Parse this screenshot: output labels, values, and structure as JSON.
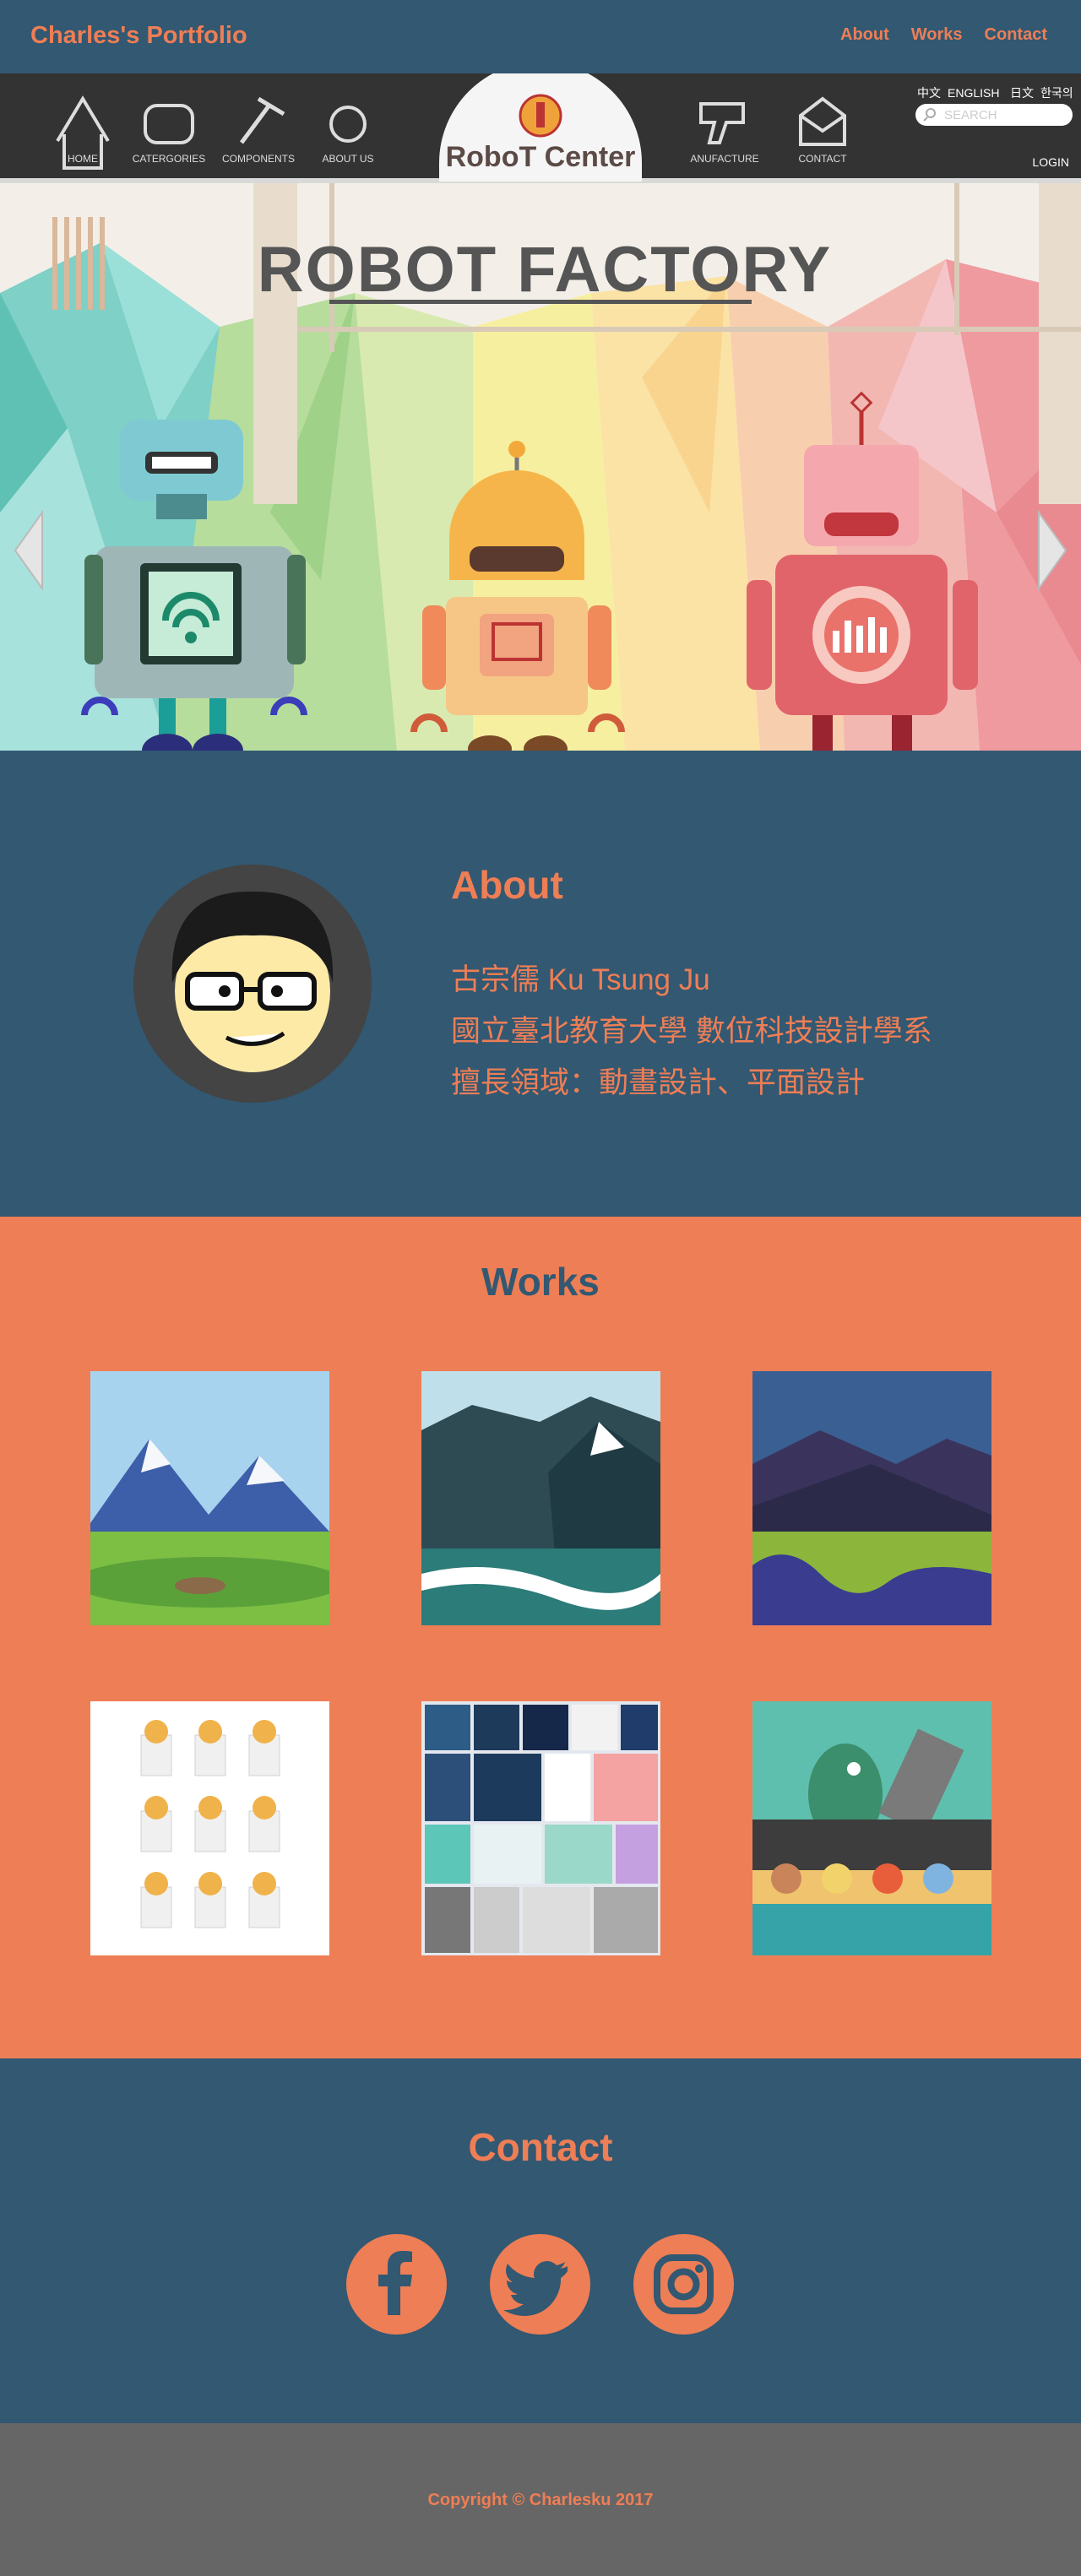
{
  "nav": {
    "brand": "Charles's Portfolio",
    "links": [
      "About",
      "Works",
      "Contact"
    ]
  },
  "hero": {
    "menu": [
      "HOME",
      "CATERGORIES",
      "COMPONENTS",
      "ABOUT US",
      "ANUFACTURE",
      "CONTACT"
    ],
    "logo_text": "RoboT Center",
    "languages": [
      "中文",
      "ENGLISH",
      "日文",
      "한국의"
    ],
    "search_placeholder": "SEARCH",
    "login": "LOGIN",
    "banner_title": "ROBOT FACTORY"
  },
  "about": {
    "heading": "About",
    "lines": [
      "古宗儒 Ku Tsung Ju",
      "國立臺北教育大學 數位科技設計學系",
      "擅長領域：動畫設計、平面設計"
    ]
  },
  "works": {
    "heading": "Works",
    "items": [
      "mountain-meadow",
      "mountain-waves",
      "mountain-lavender",
      "character-stickers",
      "poster-grid",
      "dino-robot-collage"
    ]
  },
  "contact": {
    "heading": "Contact",
    "socials": [
      "facebook-icon",
      "twitter-icon",
      "instagram-icon"
    ]
  },
  "footer": {
    "copyright": "Copyright © Charlesku 2017"
  },
  "colors": {
    "navy": "#325872",
    "orange": "#ee7e55",
    "footer_gray": "#666666",
    "bar_dark": "#333333"
  }
}
